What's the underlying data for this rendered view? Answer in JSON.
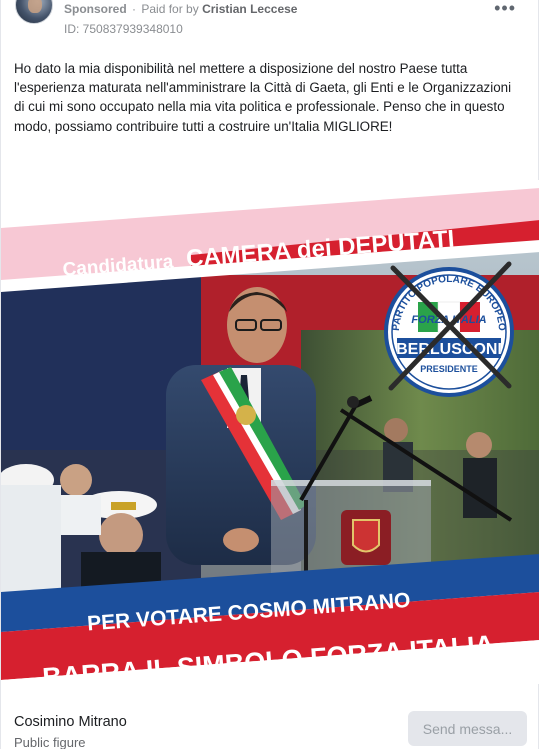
{
  "header": {
    "sponsored_label": "Sponsored",
    "separator": "·",
    "paid_for_by_label": "Paid for by",
    "payer": "Cristian Leccese",
    "ad_id": "ID: 750837939348010",
    "more_icon": "more-horizontal-icon"
  },
  "post": {
    "text": "Ho dato la mia disponibilità nel mettere a disposizione del nostro Paese tutta l'esperienza maturata nell'amministrare la Città di Gaeta, gli Enti e le Organizzazioni di cui mi sono occupato nella mia vita politica e professionale. Penso che in questo modo, possiamo contribuire tutti a costruire un'Italia MIGLIORE!"
  },
  "creative": {
    "banner_top_prefix": "Candidatura",
    "banner_top_main": "CAMERA dei DEPUTATI",
    "logo_arc_text": "PARTITO POPOLARE EUROPEO",
    "logo_center_text": "FORZA ITALIA",
    "logo_name": "BERLUSCONI",
    "logo_subtitle": "PRESIDENTE",
    "banner_bottom_line1": "PER VOTARE COSMO MITRANO",
    "banner_bottom_line2": "BARRA IL SIMBOLO FORZA ITALIA",
    "colors": {
      "pink_banner": "#f7c8d4",
      "red": "#d6202f",
      "blue": "#1c4f9c",
      "cross": "#2b2b2b"
    }
  },
  "footer": {
    "page_name": "Cosimino Mitrano",
    "page_category": "Public figure",
    "send_button_label": "Send messa..."
  }
}
